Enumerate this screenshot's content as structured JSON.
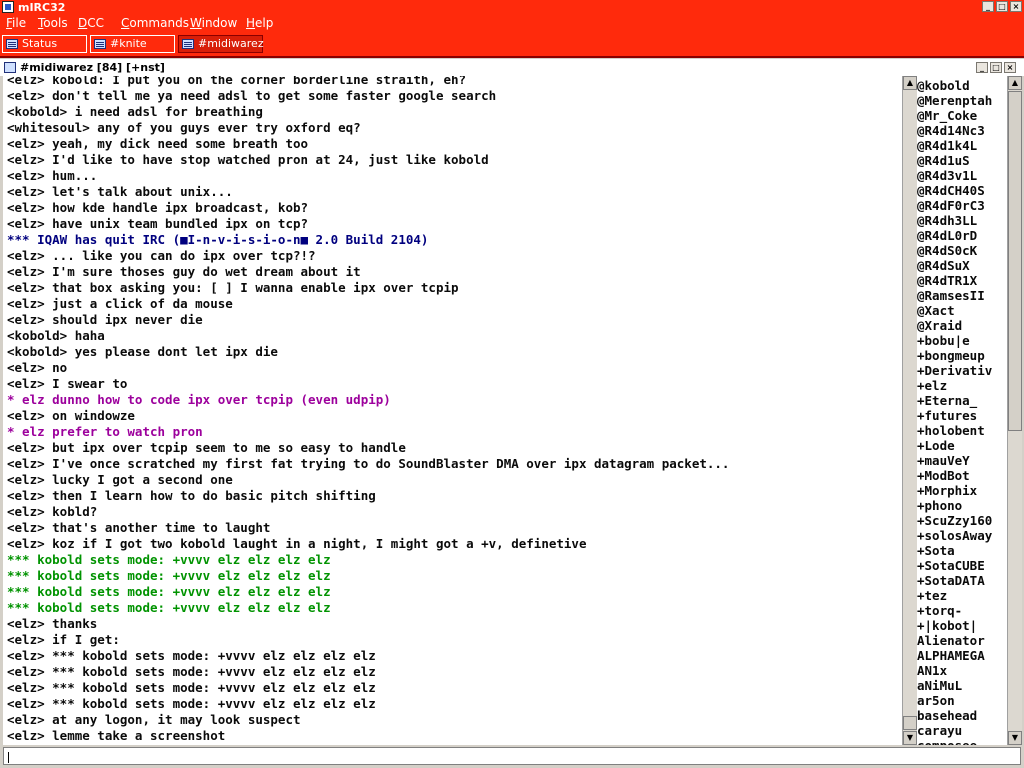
{
  "app": {
    "title": "mIRC32"
  },
  "menu": [
    "File",
    "Tools",
    "DCC",
    "Commands",
    "Window",
    "Help"
  ],
  "switchbar": [
    {
      "label": "Status",
      "active": false
    },
    {
      "label": "#knite",
      "active": false
    },
    {
      "label": "#midiwarez",
      "active": true
    }
  ],
  "channel": {
    "title": "#midiwarez [84] [+nst]",
    "input_value": ""
  },
  "chat": [
    {
      "type": "normal",
      "text": "<elz> kobold: I put you on the corner borderline straith, eh?"
    },
    {
      "type": "normal",
      "text": "<elz> don't tell me ya need adsl to get some faster google search"
    },
    {
      "type": "normal",
      "text": "<kobold> i need adsl for breathing"
    },
    {
      "type": "normal",
      "text": "<whitesoul> any of you guys ever try oxford eq?"
    },
    {
      "type": "normal",
      "text": "<elz> yeah, my dick need some breath too"
    },
    {
      "type": "normal",
      "text": "<elz> I'd like to have stop watched pron at 24, just like kobold"
    },
    {
      "type": "normal",
      "text": "<elz> hum..."
    },
    {
      "type": "normal",
      "text": "<elz> let's talk about unix..."
    },
    {
      "type": "normal",
      "text": "<elz> how kde handle ipx broadcast, kob?"
    },
    {
      "type": "normal",
      "text": "<elz> have unix team bundled ipx on tcp?"
    },
    {
      "type": "quit",
      "text": "*** IQAW has quit IRC (■I-n-v-i-s-i-o-n■ 2.0 Build 2104)"
    },
    {
      "type": "normal",
      "text": "<elz> ... like you can do ipx over tcp?!?"
    },
    {
      "type": "normal",
      "text": "<elz> I'm sure thoses guy do wet dream about it"
    },
    {
      "type": "normal",
      "text": "<elz> that box asking you: [ ] I wanna enable ipx over tcpip"
    },
    {
      "type": "normal",
      "text": "<elz> just a click of da mouse"
    },
    {
      "type": "normal",
      "text": "<elz> should ipx never die"
    },
    {
      "type": "normal",
      "text": "<kobold> haha"
    },
    {
      "type": "normal",
      "text": "<kobold> yes please dont let ipx die"
    },
    {
      "type": "normal",
      "text": "<elz> no"
    },
    {
      "type": "normal",
      "text": "<elz> I swear to"
    },
    {
      "type": "action",
      "text": "* elz dunno how to code ipx over tcpip (even udpip)"
    },
    {
      "type": "normal",
      "text": "<elz> on windowze"
    },
    {
      "type": "action",
      "text": "* elz prefer to watch pron"
    },
    {
      "type": "normal",
      "text": "<elz> but ipx over tcpip seem to me so easy to handle"
    },
    {
      "type": "normal",
      "text": "<elz> I've once scratched my first fat trying to do SoundBlaster DMA over ipx datagram packet..."
    },
    {
      "type": "normal",
      "text": "<elz> lucky I got a second one"
    },
    {
      "type": "normal",
      "text": "<elz> then I learn how to do basic pitch shifting"
    },
    {
      "type": "normal",
      "text": "<elz> kobld?"
    },
    {
      "type": "normal",
      "text": "<elz> that's another time to laught"
    },
    {
      "type": "normal",
      "text": "<elz> koz if I got two kobold laught in a night, I might got a +v, definetive"
    },
    {
      "type": "mode",
      "text": "*** kobold sets mode: +vvvv elz elz elz elz"
    },
    {
      "type": "mode",
      "text": "*** kobold sets mode: +vvvv elz elz elz elz"
    },
    {
      "type": "mode",
      "text": "*** kobold sets mode: +vvvv elz elz elz elz"
    },
    {
      "type": "mode",
      "text": "*** kobold sets mode: +vvvv elz elz elz elz"
    },
    {
      "type": "normal",
      "text": "<elz> thanks"
    },
    {
      "type": "normal",
      "text": "<elz> if I get:"
    },
    {
      "type": "normal",
      "text": "<elz> *** kobold sets mode: +vvvv elz elz elz elz"
    },
    {
      "type": "normal",
      "text": "<elz> *** kobold sets mode: +vvvv elz elz elz elz"
    },
    {
      "type": "normal",
      "text": "<elz> *** kobold sets mode: +vvvv elz elz elz elz"
    },
    {
      "type": "normal",
      "text": "<elz> *** kobold sets mode: +vvvv elz elz elz elz"
    },
    {
      "type": "normal",
      "text": "<elz> at any logon, it may look suspect"
    },
    {
      "type": "normal",
      "text": "<elz> lemme take a screenshot"
    }
  ],
  "nicks": [
    "@kobold",
    "@Merenptah",
    "@Mr_Coke",
    "@R4d14Nc3",
    "@R4d1k4L",
    "@R4d1uS",
    "@R4d3v1L",
    "@R4dCH40S",
    "@R4dF0rC3",
    "@R4dh3LL",
    "@R4dL0rD",
    "@R4dS0cK",
    "@R4dSuX",
    "@R4dTR1X",
    "@RamsesII",
    "@Xact",
    "@Xraid",
    "+bobu|e",
    "+bongmeup",
    "+Derivativ",
    "+elz",
    "+Eterna_",
    "+futures",
    "+holobent",
    "+Lode",
    "+mauVeY",
    "+ModBot",
    "+Morphix",
    "+phono",
    "+ScuZzy160",
    "+solosAway",
    "+Sota",
    "+SotaCUBE",
    "+SotaDATA",
    "+tez",
    "+torq-",
    "+|kobot|",
    "Alienator",
    "ALPHAMEGA",
    "AN1x",
    "aNiMuL",
    "ar5on",
    "basehead",
    "carayu",
    "composee"
  ]
}
